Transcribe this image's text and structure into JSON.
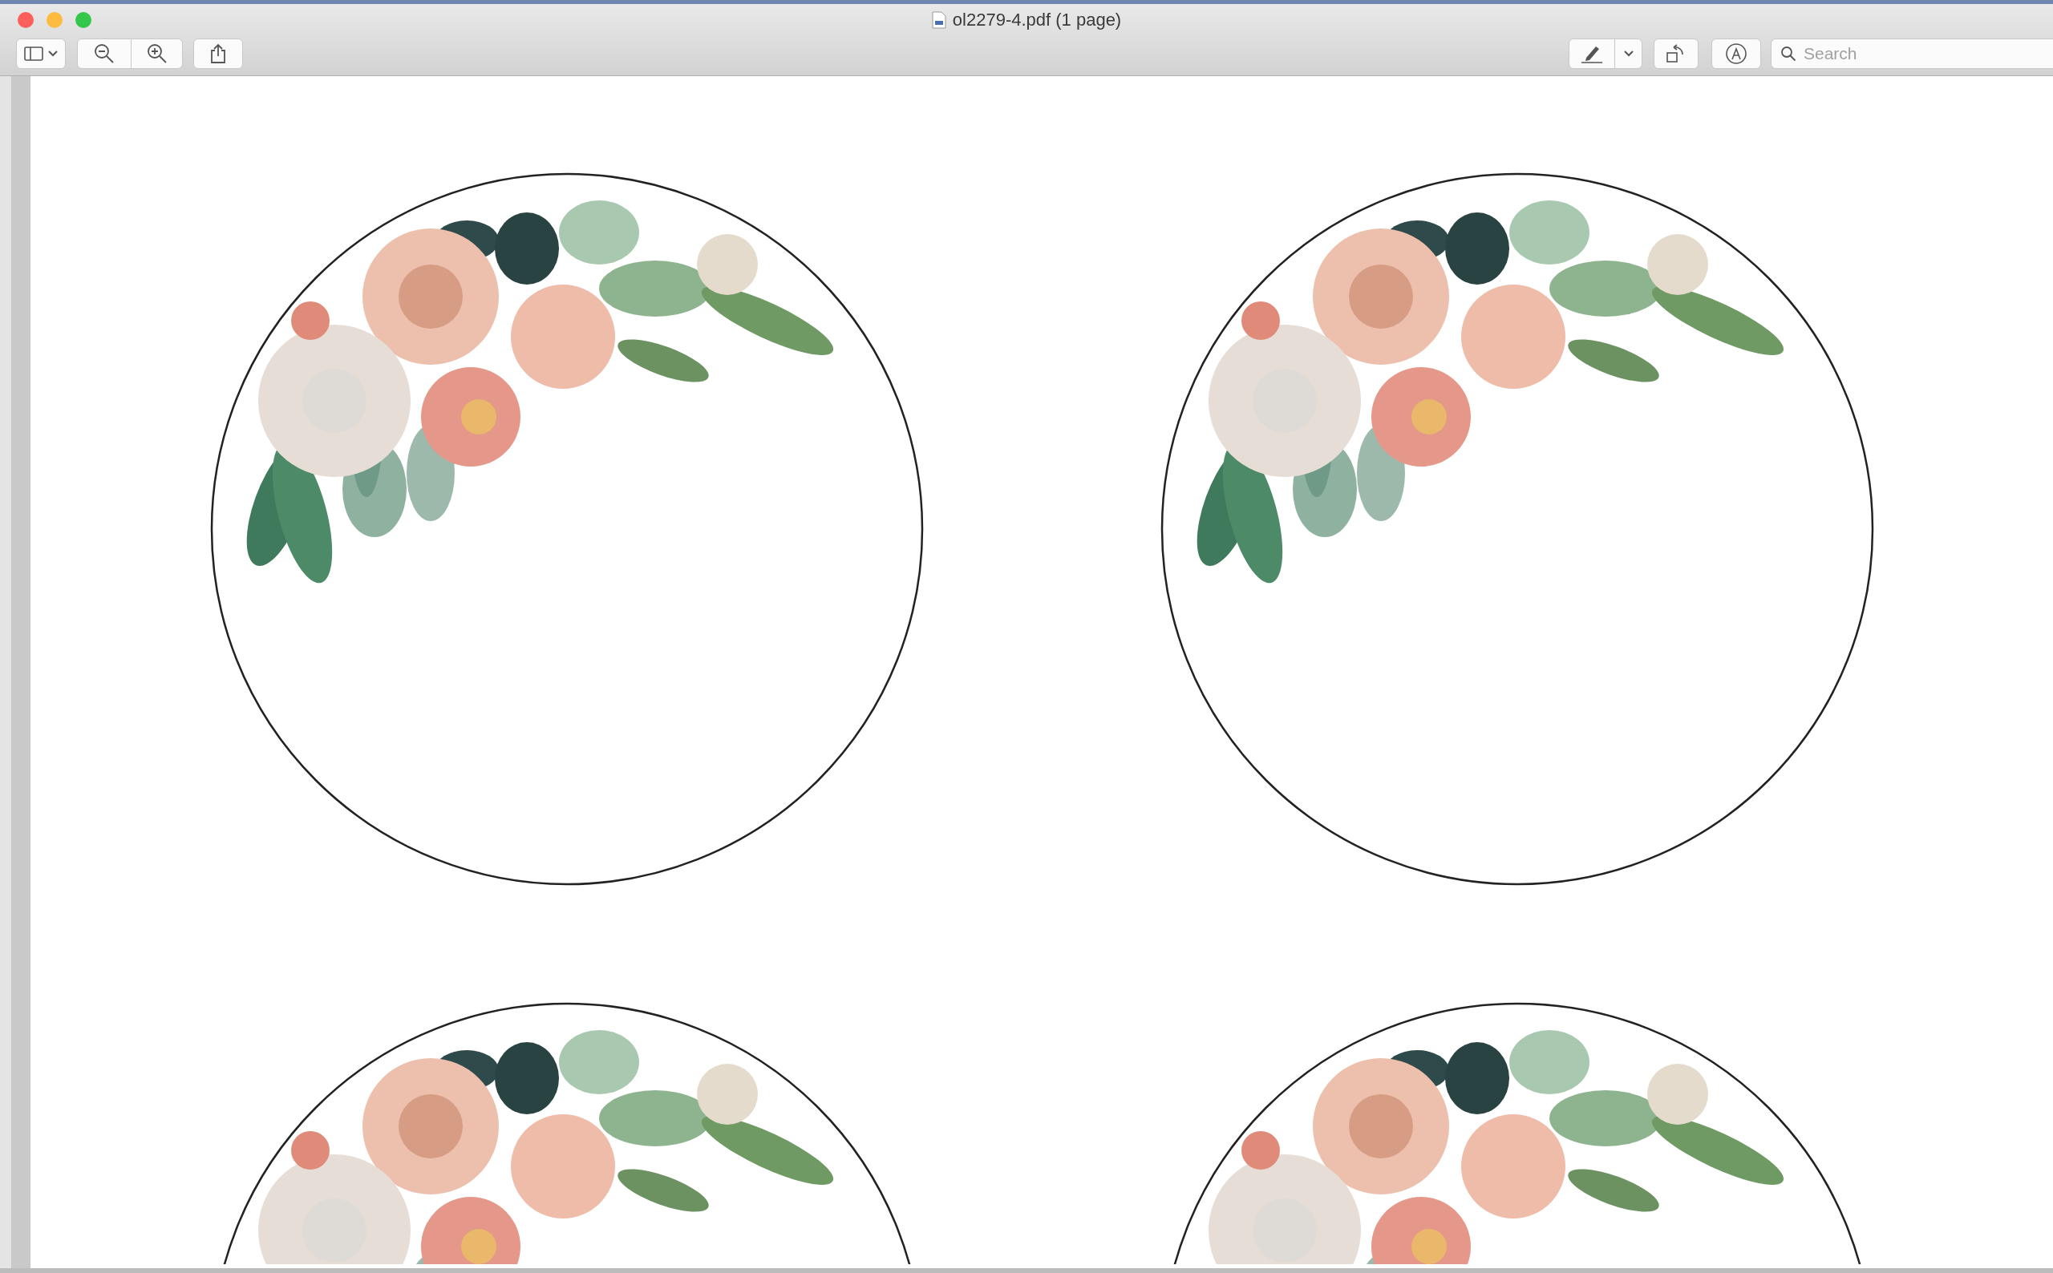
{
  "window": {
    "title": "ol2279-4.pdf (1 page)"
  },
  "toolbar": {
    "search": {
      "placeholder": "Search"
    }
  }
}
